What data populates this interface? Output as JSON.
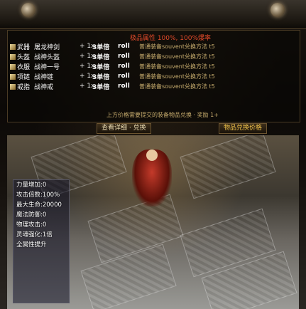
{
  "header": {
    "title": "极品属性 100%, 100%爆率"
  },
  "item_rows": [
    {
      "slot": "武器",
      "name": "屠龙神剑",
      "count": "+ 1x",
      "num": "3单倍",
      "roll": "roll",
      "hint": "普通装备souvent兑换方法 t5"
    },
    {
      "slot": "头盔",
      "name": "战神头盔",
      "count": "+ 1x",
      "num": "3单倍",
      "roll": "roll",
      "hint": "普通装备souvent兑换方法 t5"
    },
    {
      "slot": "衣服",
      "name": "战神一号",
      "count": "+ 1x",
      "num": "3单倍",
      "roll": "roll",
      "hint": "普通装备souvent兑换方法 t5"
    },
    {
      "slot": "项链",
      "name": "战神链",
      "count": "+ 1x",
      "num": "3单倍",
      "roll": "roll",
      "hint": "普通装备souvent兑换方法 t5"
    },
    {
      "slot": "戒指",
      "name": "战神戒",
      "count": "+ 1x",
      "num": "3单倍",
      "roll": "roll",
      "hint": "普通装备souvent兑换方法 t5"
    }
  ],
  "panel_foot": "上方价格需要提交的装备物品兑换 · 奖励 1+",
  "buttons": {
    "left_label": "查看详细 · 兑换",
    "right_label": "物品兑换价格"
  },
  "stats": [
    "力量增加:0",
    "攻击倍数:100%",
    "最大生命:20000",
    "魔法防御:0",
    "物理攻击:0",
    "灵魂强化:1倍",
    "全属性提升"
  ]
}
